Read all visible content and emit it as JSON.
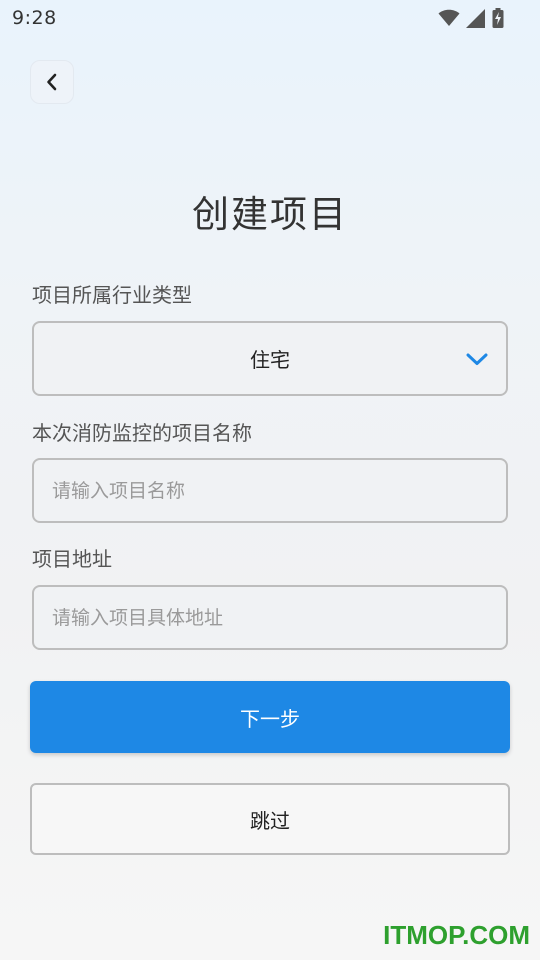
{
  "status_bar": {
    "time": "9:28",
    "icons": [
      "wifi-icon",
      "cell-signal-icon",
      "battery-charging-icon"
    ]
  },
  "header": {
    "back_icon": "chevron-left-icon",
    "title": "创建项目"
  },
  "form": {
    "industry": {
      "label": "项目所属行业类型",
      "selected": "住宅",
      "icon": "chevron-down-icon"
    },
    "project_name": {
      "label": "本次消防监控的项目名称",
      "value": "",
      "placeholder": "请输入项目名称"
    },
    "project_address": {
      "label": "项目地址",
      "value": "",
      "placeholder": "请输入项目具体地址"
    }
  },
  "actions": {
    "next_label": "下一步",
    "skip_label": "跳过"
  },
  "watermark": "ITMOP.COM",
  "colors": {
    "accent": "#1e88e5",
    "chevron": "#1e88e5",
    "watermark": "#2ea02e"
  }
}
